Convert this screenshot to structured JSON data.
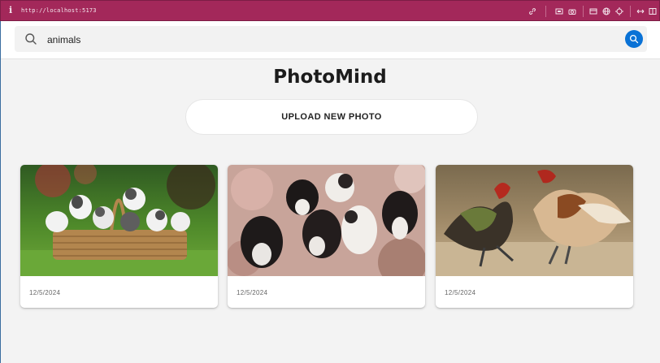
{
  "browser": {
    "info_glyph": "i",
    "url": "http://localhost:5173",
    "icons": [
      "link-icon",
      "screen-icon",
      "camera-icon",
      "window-icon",
      "globe-icon",
      "target-icon",
      "expand-icon",
      "sidebar-icon"
    ]
  },
  "search": {
    "value": "animals",
    "placeholder": "",
    "button_icon": "search-icon"
  },
  "app": {
    "title": "PhotoMind",
    "upload_label": "UPLOAD NEW PHOTO"
  },
  "photos": [
    {
      "subject": "puppies in a wicker basket",
      "date": "12/5/2024"
    },
    {
      "subject": "group of kittens",
      "date": "12/5/2024"
    },
    {
      "subject": "two roosters fighting",
      "date": "12/5/2024"
    }
  ],
  "colors": {
    "chrome_bar": "#a3285a",
    "accent": "#0a72d6",
    "background": "#f3f3f3"
  }
}
